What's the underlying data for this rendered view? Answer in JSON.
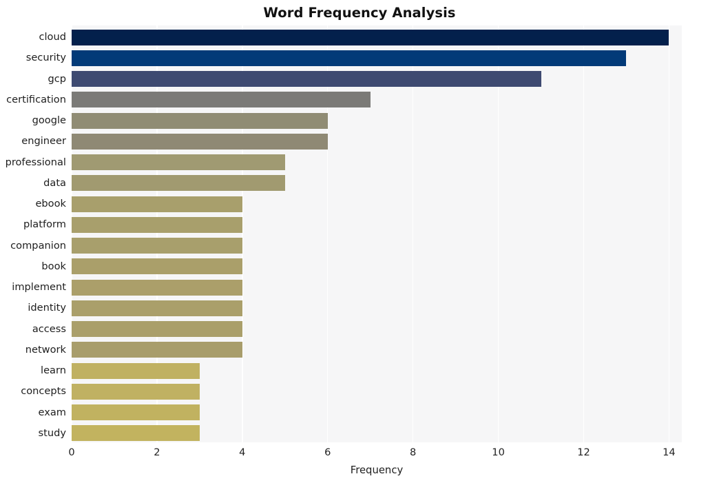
{
  "chart_data": {
    "type": "bar",
    "orientation": "horizontal",
    "title": "Word Frequency Analysis",
    "xlabel": "Frequency",
    "ylabel": "",
    "xlim": [
      0,
      14.3
    ],
    "xticks": [
      0,
      2,
      4,
      6,
      8,
      10,
      12,
      14
    ],
    "xtick_labels": [
      "0",
      "2",
      "4",
      "6",
      "8",
      "10",
      "12",
      "14"
    ],
    "grid": "vertical-only",
    "legend": "none",
    "background": "#f6f6f7",
    "gridline_color": "#ffffff",
    "categories": [
      "cloud",
      "security",
      "gcp",
      "certification",
      "google",
      "engineer",
      "professional",
      "data",
      "ebook",
      "platform",
      "companion",
      "book",
      "implement",
      "identity",
      "access",
      "network",
      "learn",
      "concepts",
      "exam",
      "study"
    ],
    "values": [
      14,
      13,
      11,
      7,
      6,
      6,
      5,
      5,
      4,
      4,
      4,
      4,
      4,
      4,
      4,
      4,
      3,
      3,
      3,
      3
    ],
    "bar_colors": [
      "#03204c",
      "#023a78",
      "#3e4a71",
      "#7b7a77",
      "#908c74",
      "#8f8974",
      "#a09a72",
      "#a19a70",
      "#a89f6c",
      "#a89f6c",
      "#a89f6c",
      "#aa9f6a",
      "#ab9f6a",
      "#aa9f6a",
      "#aa9f6a",
      "#a89d6b",
      "#c0b162",
      "#c0b162",
      "#c1b260",
      "#c2b35f"
    ]
  }
}
